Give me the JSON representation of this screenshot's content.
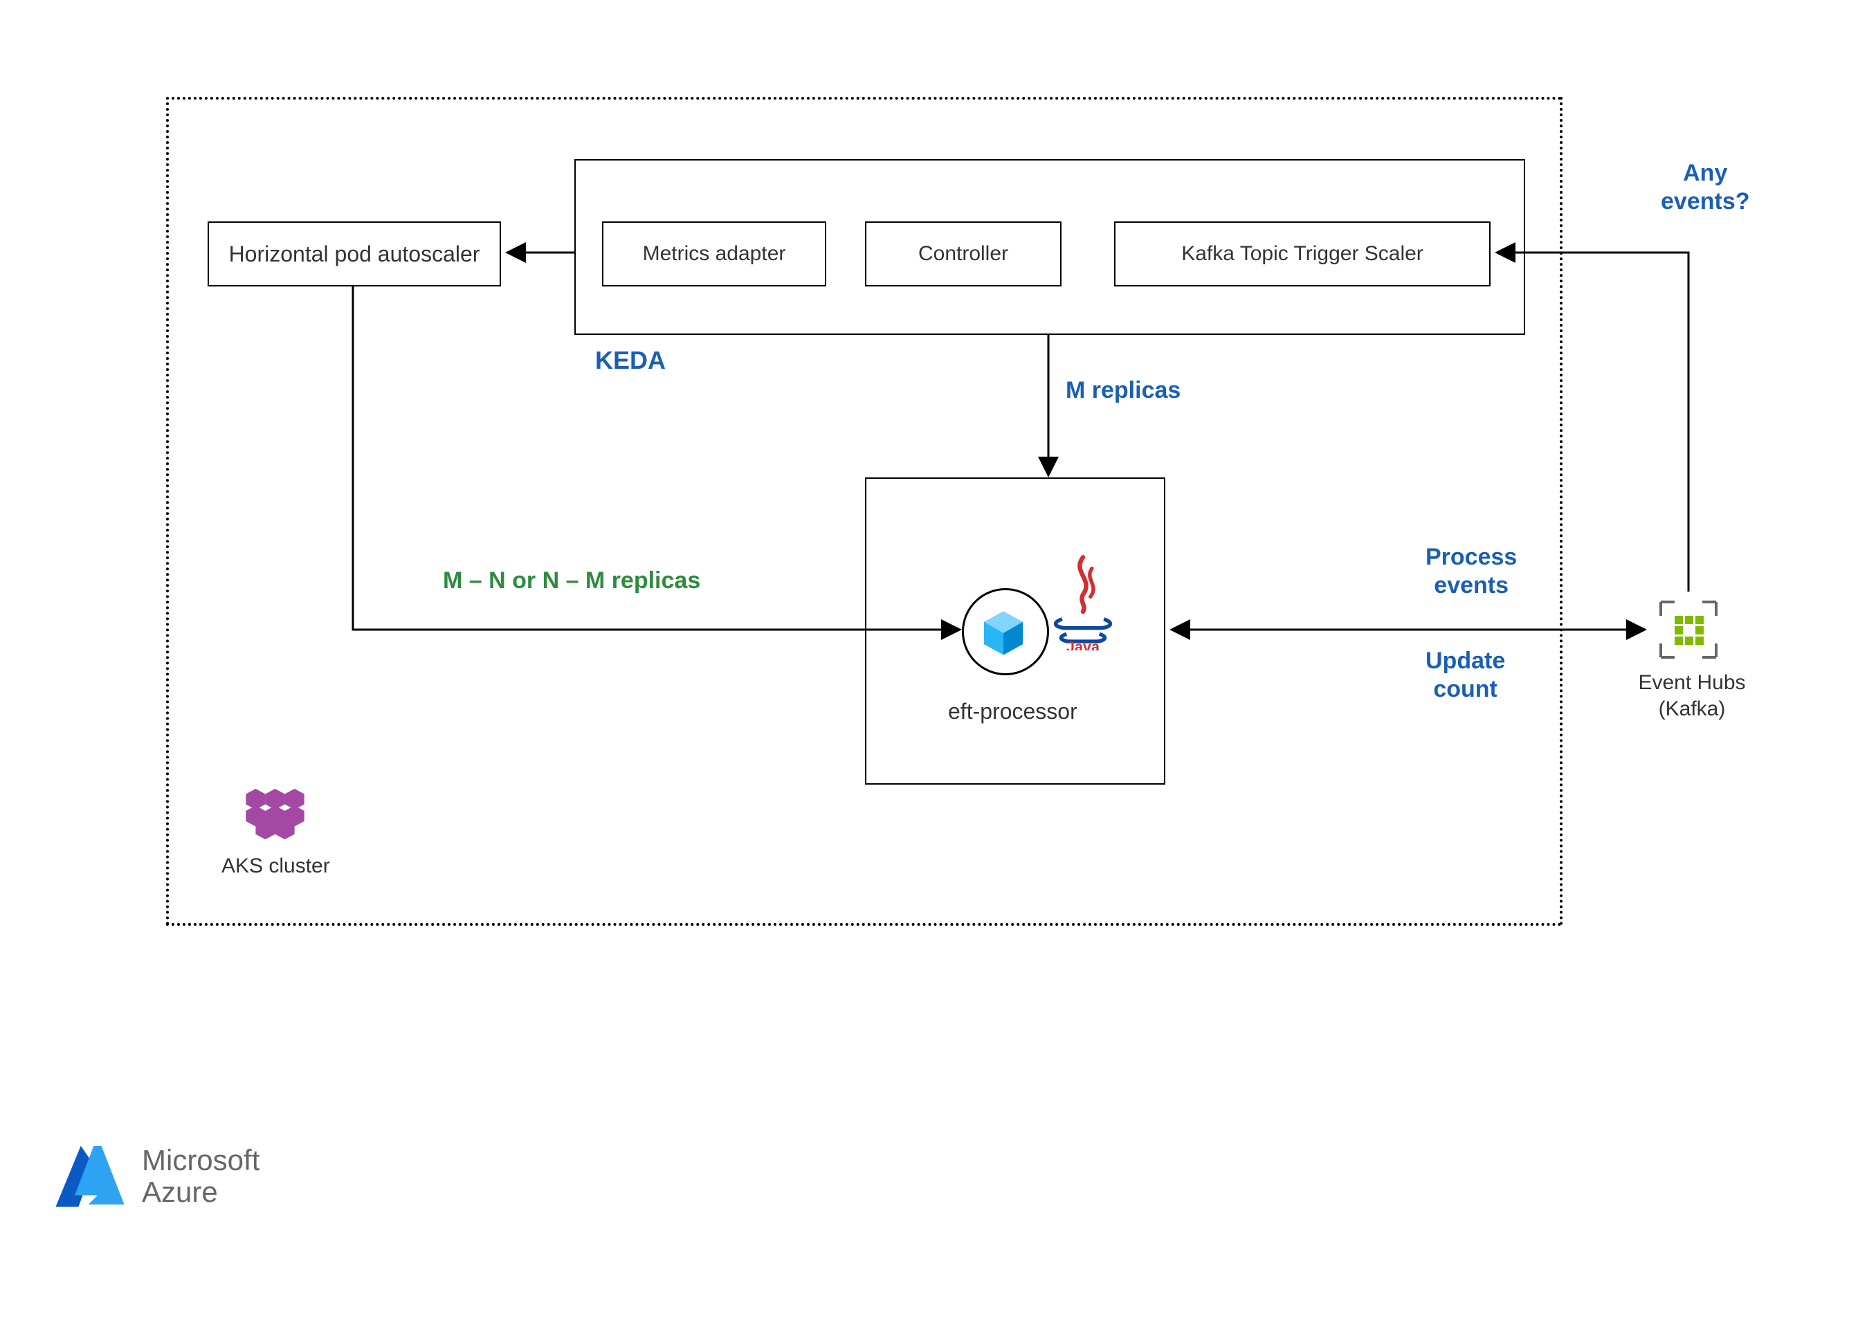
{
  "cluster_label": "AKS cluster",
  "hpa": {
    "label": "Horizontal pod autoscaler"
  },
  "keda": {
    "label": "KEDA",
    "metrics_adapter": "Metrics adapter",
    "controller": "Controller",
    "scaler": "Kafka Topic Trigger Scaler"
  },
  "eft": {
    "label": "eft-processor"
  },
  "event_hubs": {
    "line1": "Event Hubs",
    "line2": "(Kafka)"
  },
  "labels": {
    "any_events": "Any\nevents?",
    "m_replicas": "M replicas",
    "hpa_replicas": "M – N or N – M replicas",
    "process_events": "Process\nevents",
    "update_count": "Update\ncount"
  },
  "logo": {
    "line1": "Microsoft",
    "line2": "Azure"
  },
  "colors": {
    "accent_blue": "#1a5fb4",
    "green": "#2e8b3f",
    "azure_blue": "#0078d4",
    "event_hubs_green": "#7fba00",
    "java_red": "#d32f2f",
    "java_blue": "#0d47a1",
    "aks_purple": "#a349a4",
    "cube_blue": "#29b6f6"
  }
}
